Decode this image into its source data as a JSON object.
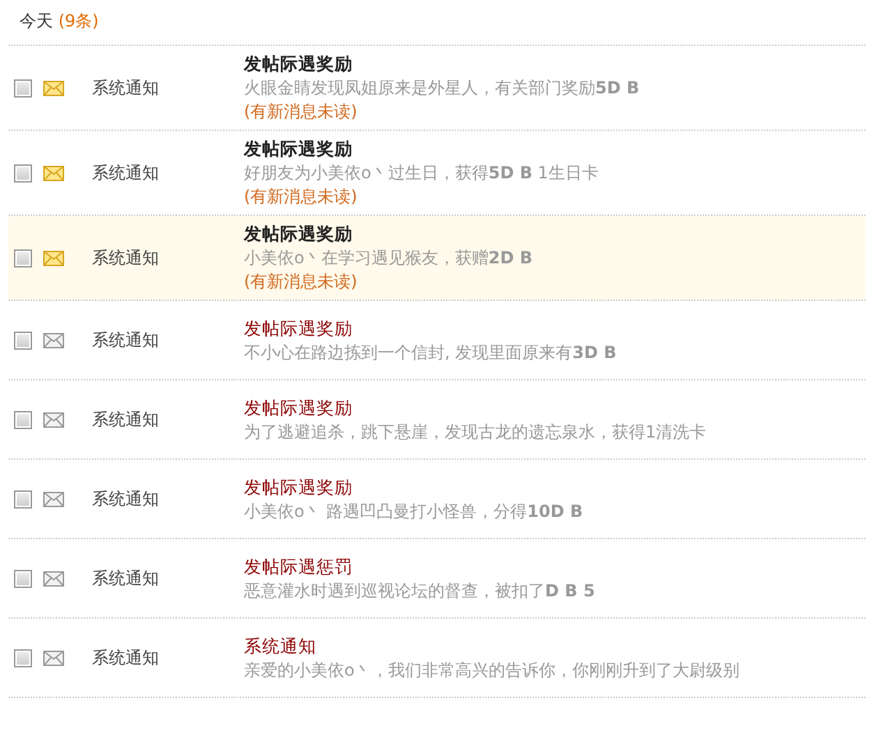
{
  "header": {
    "label": "今天",
    "count": "(9条)"
  },
  "messages": [
    {
      "checked": false,
      "unread": true,
      "selected": false,
      "sender": "系统通知",
      "title": "发帖际遇奖励",
      "body": "火眼金睛发现凤姐原来是外星人，有关部门奖励**5D B**",
      "note": "(有新消息未读)"
    },
    {
      "checked": false,
      "unread": true,
      "selected": false,
      "sender": "系统通知",
      "title": "发帖际遇奖励",
      "body": "好朋友为小美依o丶过生日，获得**5D B** 1生日卡",
      "note": "(有新消息未读)"
    },
    {
      "checked": false,
      "unread": true,
      "selected": true,
      "sender": "系统通知",
      "title": "发帖际遇奖励",
      "body": "小美依o丶在学习遇见猴友，获赠**2D B**",
      "note": "(有新消息未读)"
    },
    {
      "checked": false,
      "unread": false,
      "selected": false,
      "sender": "系统通知",
      "title": "发帖际遇奖励",
      "body": "不小心在路边拣到一个信封, 发现里面原来有**3D B**"
    },
    {
      "checked": false,
      "unread": false,
      "selected": false,
      "sender": "系统通知",
      "title": "发帖际遇奖励",
      "body": "为了逃避追杀，跳下悬崖，发现古龙的遗忘泉水，获得1清洗卡"
    },
    {
      "checked": false,
      "unread": false,
      "selected": false,
      "sender": "系统通知",
      "title": "发帖际遇奖励",
      "body": "小美依o丶 路遇凹凸曼打小怪兽，分得**10D B**"
    },
    {
      "checked": false,
      "unread": false,
      "selected": false,
      "sender": "系统通知",
      "title": "发帖际遇惩罚",
      "body": "恶意灌水时遇到巡视论坛的督查，被扣了**D B 5**"
    },
    {
      "checked": false,
      "unread": false,
      "selected": false,
      "sender": "系统通知",
      "title": "系统通知",
      "body": "亲爱的小美依o丶，我们非常高兴的告诉你，你刚刚升到了大尉级别"
    }
  ]
}
